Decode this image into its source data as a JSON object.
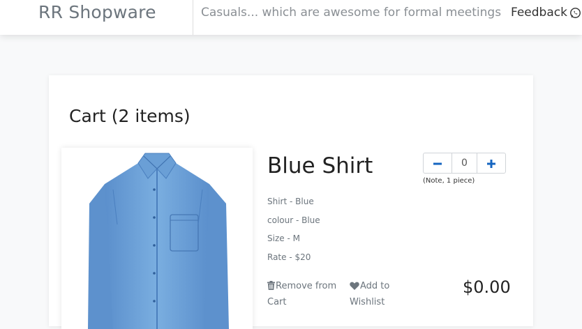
{
  "header": {
    "brand_prefix": "RR",
    "brand_name": "Shopware",
    "tagline": "Casuals... which are awesome for formal meetings",
    "feedback_label": "Feedback",
    "feedback_icon": "whatsapp-icon"
  },
  "cart": {
    "title": "Cart (2 items)",
    "items": [
      {
        "name": "Blue Shirt",
        "image_icon": "blue-shirt-image",
        "specs": [
          "Shirt - Blue",
          "colour - Blue",
          "Size - M",
          "Rate - $20"
        ],
        "quantity": "0",
        "quantity_note": "(Note, 1 piece)",
        "remove_label_line1": "Remove from",
        "remove_label_line2": "Cart",
        "wishlist_label_line1": "Add to",
        "wishlist_label_line2": "Wishlist",
        "price": "$0.00"
      }
    ]
  },
  "colors": {
    "accent": "#1565c0",
    "shirt": "#6a9fd6"
  }
}
